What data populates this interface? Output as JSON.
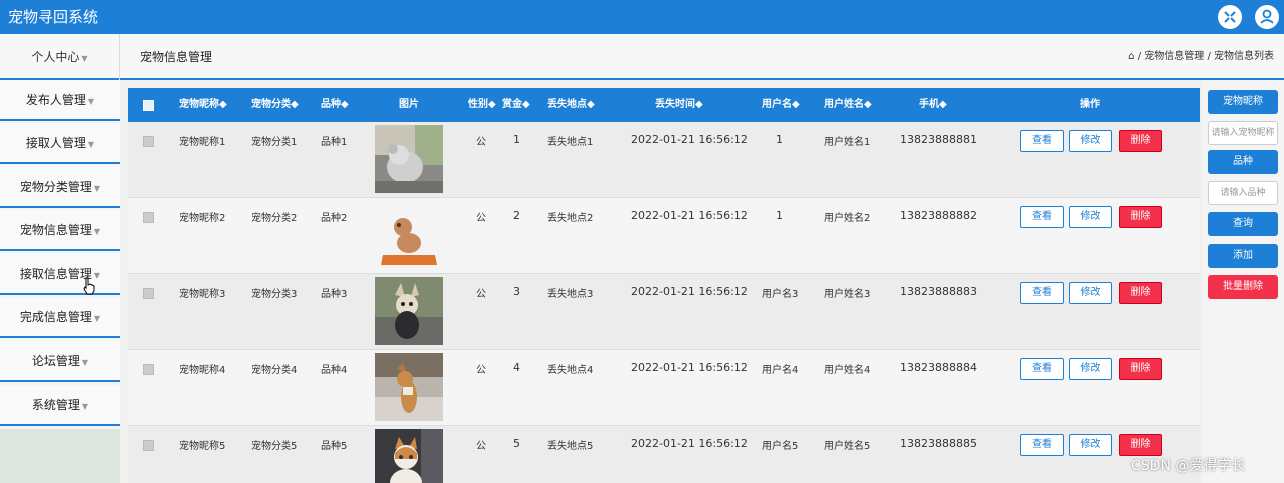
{
  "app": {
    "title": "宠物寻回系统"
  },
  "icons": {
    "expand": "expand-icon",
    "user": "user-icon",
    "home": "home-icon"
  },
  "header": {
    "personal_label": "个人中心",
    "page_title": "宠物信息管理",
    "breadcrumb": "/ 宠物信息管理 / 宠物信息列表"
  },
  "sidebar": {
    "items": [
      {
        "label": "发布人管理"
      },
      {
        "label": "接取人管理"
      },
      {
        "label": "宠物分类管理"
      },
      {
        "label": "宠物信息管理"
      },
      {
        "label": "接取信息管理"
      },
      {
        "label": "完成信息管理"
      },
      {
        "label": "论坛管理"
      },
      {
        "label": "系统管理"
      }
    ]
  },
  "table": {
    "headers": [
      "宠物昵称",
      "宠物分类",
      "品种",
      "图片",
      "性别",
      "赏金",
      "丢失地点",
      "丢失时间",
      "用户名",
      "用户姓名",
      "手机",
      "操作"
    ],
    "sort_mark": "◆",
    "actions": {
      "view": "查看",
      "edit": "修改",
      "delete": "删除"
    },
    "rows": [
      {
        "name": "宠物昵称1",
        "category": "宠物分类1",
        "breed": "品种1",
        "gender": "公",
        "reward": "1",
        "location": "丢失地点1",
        "time": "2022-01-21 16:56:12",
        "username": "1",
        "realname": "用户姓名1",
        "phone": "13823888881"
      },
      {
        "name": "宠物昵称2",
        "category": "宠物分类2",
        "breed": "品种2",
        "gender": "公",
        "reward": "2",
        "location": "丢失地点2",
        "time": "2022-01-21 16:56:12",
        "username": "1",
        "realname": "用户姓名2",
        "phone": "13823888882"
      },
      {
        "name": "宠物昵称3",
        "category": "宠物分类3",
        "breed": "品种3",
        "gender": "公",
        "reward": "3",
        "location": "丢失地点3",
        "time": "2022-01-21 16:56:12",
        "username": "用户名3",
        "realname": "用户姓名3",
        "phone": "13823888883"
      },
      {
        "name": "宠物昵称4",
        "category": "宠物分类4",
        "breed": "品种4",
        "gender": "公",
        "reward": "4",
        "location": "丢失地点4",
        "time": "2022-01-21 16:56:12",
        "username": "用户名4",
        "realname": "用户姓名4",
        "phone": "13823888884"
      },
      {
        "name": "宠物昵称5",
        "category": "宠物分类5",
        "breed": "品种5",
        "gender": "公",
        "reward": "5",
        "location": "丢失地点5",
        "time": "2022-01-21 16:56:12",
        "username": "用户名5",
        "realname": "用户姓名5",
        "phone": "13823888885"
      }
    ]
  },
  "search": {
    "nickname_label": "宠物昵称",
    "nickname_placeholder": "请输入宠物昵称",
    "breed_label": "品种",
    "breed_placeholder": "请输入品种",
    "query_label": "查询",
    "add_label": "添加",
    "batch_delete_label": "批量删除"
  },
  "watermark": "CSDN @爱得学长",
  "colors": {
    "primary": "#1e7fd6",
    "danger": "#f4314a"
  }
}
